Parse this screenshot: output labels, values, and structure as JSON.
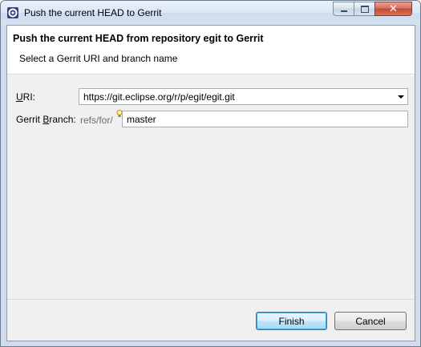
{
  "window": {
    "title": "Push the current HEAD to Gerrit",
    "icon": "eclipse-gear-icon",
    "controls": {
      "minimize": "minimize-icon",
      "maximize": "maximize-icon",
      "close": "close-icon"
    }
  },
  "banner": {
    "title": "Push the current HEAD from repository egit to Gerrit",
    "subtitle": "Select a Gerrit URI and branch name"
  },
  "form": {
    "uri_label_mnemonic": "U",
    "uri_label_rest": "RI:",
    "uri_value": "https://git.eclipse.org/r/p/egit/egit.git",
    "branch_label_prefix": "Gerrit ",
    "branch_label_mnemonic": "B",
    "branch_label_rest": "ranch:",
    "branch_prefix": "refs/for/",
    "branch_value": "master",
    "content_assist_icon": "lightbulb-icon"
  },
  "buttons": {
    "finish": "Finish",
    "cancel": "Cancel"
  },
  "colors": {
    "title_bar": "#dbe7f4",
    "dialog_bg": "#f0f0f0",
    "default_button_border": "#3c7fb1",
    "close_button": "#c24a33"
  }
}
